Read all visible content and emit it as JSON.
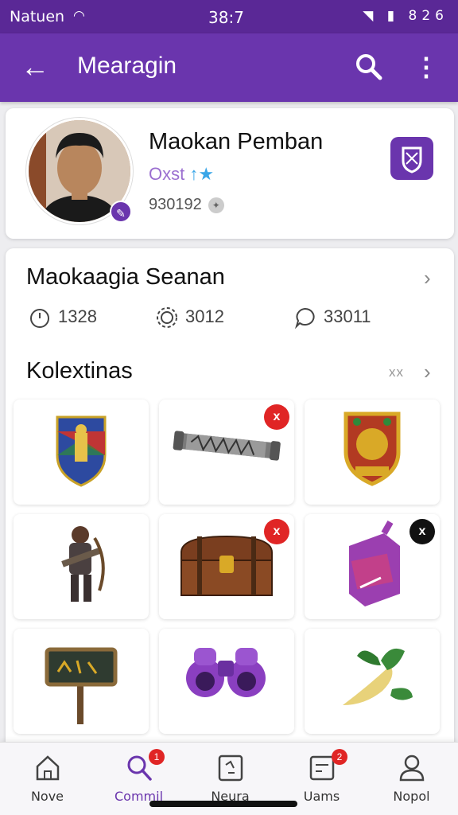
{
  "status_bar": {
    "carrier": "Natuen",
    "time": "38:7",
    "right": "826"
  },
  "app_bar": {
    "title": "Mearagin",
    "back_icon": "back-arrow-icon",
    "search_icon": "search-icon",
    "more_icon": "more-vertical-icon"
  },
  "profile": {
    "name": "Maokan Pemban",
    "subtitle": "Oxst",
    "id": "930192",
    "action_icon": "shield-icon",
    "accent": "#6a35ad"
  },
  "stats_section": {
    "title": "Maokaagia Seanan",
    "stats": [
      {
        "icon": "timer-icon",
        "value": "1328"
      },
      {
        "icon": "gear-icon",
        "value": "3012"
      },
      {
        "icon": "chat-icon",
        "value": "33011"
      }
    ]
  },
  "collections": {
    "title": "Kolextinas",
    "extra": "xx",
    "items": [
      {
        "name": "shield-crest",
        "badge": null
      },
      {
        "name": "metal-rod",
        "badge": "x"
      },
      {
        "name": "gold-shield",
        "badge": null
      },
      {
        "name": "soldier-figure",
        "badge": null
      },
      {
        "name": "treasure-chest",
        "badge": "x"
      },
      {
        "name": "purple-pouch",
        "badge": "x"
      },
      {
        "name": "wooden-sign",
        "badge": null
      },
      {
        "name": "binoculars",
        "badge": null
      },
      {
        "name": "green-root",
        "badge": null
      }
    ]
  },
  "bottom_nav": {
    "items": [
      {
        "label": "Nove",
        "icon": "home-icon",
        "badge": null
      },
      {
        "label": "Commil",
        "icon": "search-icon",
        "badge": "1"
      },
      {
        "label": "Neura",
        "icon": "news-icon",
        "badge": null
      },
      {
        "label": "Uams",
        "icon": "message-icon",
        "badge": "2"
      },
      {
        "label": "Nopol",
        "icon": "profile-icon",
        "badge": null
      }
    ]
  }
}
